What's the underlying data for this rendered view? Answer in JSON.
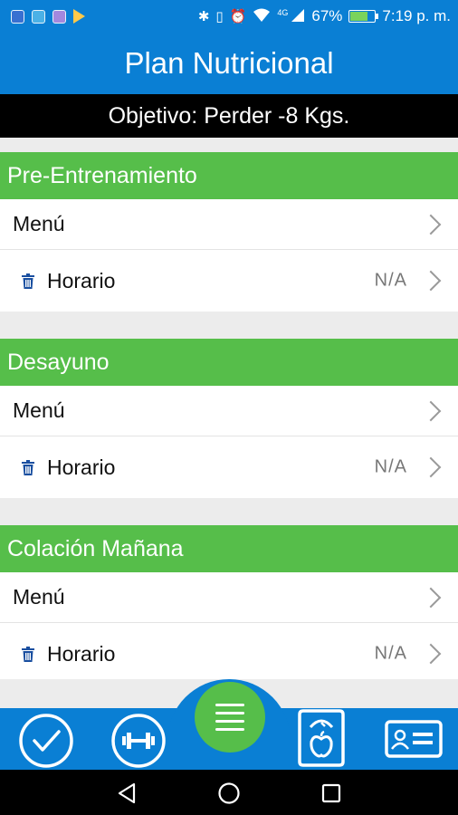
{
  "status_bar": {
    "battery": "67%",
    "time": "7:19 p. m.",
    "network": "4G",
    "battery_level": 0.67
  },
  "header": {
    "title": "Plan Nutricional"
  },
  "goal": {
    "text": "Objetivo: Perder -8 Kgs."
  },
  "sections": [
    {
      "title": "Pre-Entrenamiento",
      "menu_label": "Menú",
      "schedule_label": "Horario",
      "schedule_value": "N/A"
    },
    {
      "title": "Desayuno",
      "menu_label": "Menú",
      "schedule_label": "Horario",
      "schedule_value": "N/A"
    },
    {
      "title": "Colación Mañana",
      "menu_label": "Menú",
      "schedule_label": "Horario",
      "schedule_value": "N/A"
    }
  ],
  "tabbar": {
    "items": [
      {
        "icon": "check-circle-icon"
      },
      {
        "icon": "dumbbell-icon"
      },
      {
        "icon": "menu-lines-icon"
      },
      {
        "icon": "scale-apple-icon"
      },
      {
        "icon": "id-card-icon"
      }
    ]
  },
  "colors": {
    "primary_blue": "#0a7fd4",
    "accent_green": "#56be4a",
    "goal_bar": "#000000"
  }
}
